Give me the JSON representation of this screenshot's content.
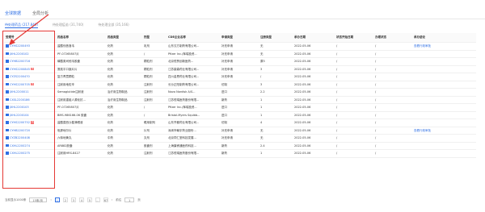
{
  "tabs": [
    {
      "label": "全球数据"
    },
    {
      "label": "全局分析"
    }
  ],
  "subtabs": [
    {
      "label": "待处理药品 (217,840)"
    },
    {
      "label": "待处理疫苗 (31,740)"
    },
    {
      "label": "待处理全部 (35,166)"
    }
  ],
  "table": {
    "headers": [
      "受理号",
      "药品名称",
      "药品类型",
      "剂型",
      "CDE企业名称",
      "申请类型",
      "注册类型",
      "承办日期",
      "状态开始日期",
      "办理状态",
      "承办结论"
    ],
    "rows": [
      {
        "code": "CYHS2200493",
        "badge": "",
        "name": "盐酸伐昔洛韦",
        "type": "化药",
        "form": "乳剂",
        "company": "山东汉方制药有限公司...",
        "apply": "补充申请",
        "reg": "无",
        "date": "2022-05-06",
        "start": "/",
        "status": "/",
        "result": "查看行政审批"
      },
      {
        "code": "JXHL2200102",
        "badge": "",
        "name": "PF-07265807片",
        "type": "化药",
        "form": "/",
        "company": "Pfizer Inc./辉瑞投资...",
        "apply": "补充申请",
        "reg": "无",
        "date": "2022-05-06",
        "start": "/",
        "status": "/",
        "result": ""
      },
      {
        "code": "CYHB2200716",
        "badge": "",
        "name": "磷酸奥司他韦胶囊",
        "type": "化药",
        "form": "颗粒剂",
        "company": "北京恒贸创新医药...",
        "apply": "补充申请",
        "reg": "原5",
        "date": "2022-05-06",
        "start": "/",
        "status": "/",
        "result": ""
      },
      {
        "code": "CYHS2200845",
        "badge": "仿",
        "name": "氯氮平口崩片片",
        "type": "化药",
        "form": "颗粒剂",
        "company": "江苏豪森药业有限公司...",
        "apply": "补充申请",
        "reg": "3",
        "date": "2022-05-06",
        "start": "/",
        "status": "/",
        "result": ""
      },
      {
        "code": "CYZS2200470",
        "badge": "",
        "name": "复方青蒿颗粒",
        "type": "化药",
        "form": "颗粒剂",
        "company": "四川金恩药业有限公司...",
        "apply": "补充申请",
        "reg": "/",
        "date": "2022-05-06",
        "start": "/",
        "status": "/",
        "result": ""
      },
      {
        "code": "CYHS2200705",
        "badge": "仿",
        "name": "注射用地佐辛",
        "type": "化药",
        "form": "注射剂",
        "company": "长沙正阳制药有限公司...",
        "apply": "仿制",
        "reg": "3",
        "date": "2022-05-06",
        "start": "/",
        "status": "/",
        "result": ""
      },
      {
        "code": "JXHL2200011",
        "badge": "",
        "name": "Semaglutide注射液",
        "type": "治疗用生物制品",
        "form": "注射剂",
        "company": "Novo Nordisk A/S...",
        "apply": "进口",
        "reg": "2.2",
        "date": "2022-05-06",
        "start": "/",
        "status": "/",
        "result": ""
      },
      {
        "code": "CXSL2200186",
        "badge": "",
        "name": "注射用重组人源化抗...",
        "type": "治疗用生物制品",
        "form": "注射剂",
        "company": "江苏恒瑞医药股份有限...",
        "apply": "新药",
        "reg": "1",
        "date": "2022-05-06",
        "start": "/",
        "status": "/",
        "result": ""
      },
      {
        "code": "JXHL2200103",
        "badge": "",
        "name": "PF-07265807片",
        "type": "化药",
        "form": "/",
        "company": "Pfizer Inc./辉瑞投资...",
        "apply": "进口",
        "reg": "1",
        "date": "2022-05-06",
        "start": "/",
        "status": "/",
        "result": ""
      },
      {
        "code": "JXHL2200104",
        "badge": "",
        "name": "BMS-986166-06 胶囊",
        "type": "化药",
        "form": "/",
        "company": "Bristol-Myers Squibb...",
        "apply": "进口",
        "reg": "1",
        "date": "2022-05-06",
        "start": "/",
        "status": "/",
        "result": ""
      },
      {
        "code": "CYHS2200752",
        "badge": "仿",
        "name": "盐酸莫西沙星滴眼液",
        "type": "化药",
        "form": "眼用制剂",
        "company": "山东齐都药业有限公司...",
        "apply": "仿制",
        "reg": "4",
        "date": "2022-05-06",
        "start": "/",
        "status": "/",
        "result": ""
      },
      {
        "code": "CYHB2200720",
        "badge": "",
        "name": "吡那地尔片",
        "type": "化药",
        "form": "片剂",
        "company": "深圳市翰宇药业股份...",
        "apply": "补充申请",
        "reg": "无",
        "date": "2022-05-06",
        "start": "/",
        "status": "/",
        "result": "查看行政审批"
      },
      {
        "code": "CYZB2200408",
        "badge": "",
        "name": "六味地黄丸",
        "type": "中药",
        "form": "丸剂",
        "company": "北京同仁堂科技发展...",
        "apply": "补充申请",
        "reg": "无",
        "date": "2022-05-06",
        "start": "/",
        "status": "/",
        "result": ""
      },
      {
        "code": "CXHL2200274",
        "badge": "",
        "name": "AR882胶囊",
        "type": "化药",
        "form": "胶囊剂",
        "company": "上海康睿通医药科技...",
        "apply": "新药",
        "reg": "2.4",
        "date": "2022-05-06",
        "start": "/",
        "status": "/",
        "result": ""
      },
      {
        "code": "CXHL2200275",
        "badge": "",
        "name": "注射用HRS-8427",
        "type": "化药",
        "form": "注射剂",
        "company": "江苏恒瑞医药股份有限...",
        "apply": "新药",
        "reg": "1",
        "date": "2022-05-06",
        "start": "/",
        "status": "/",
        "result": ""
      }
    ]
  },
  "pager": {
    "total": "当前显示1000条",
    "page_size": "15条/页",
    "pages": [
      "1",
      "2",
      "3",
      "4",
      "5",
      "...",
      "67"
    ],
    "goto_label": "前往",
    "goto_value": "1",
    "goto_suffix": "页"
  },
  "colors": {
    "accent": "#2f6fe4",
    "highlight": "#e53935",
    "badge": "#f56c6c"
  }
}
